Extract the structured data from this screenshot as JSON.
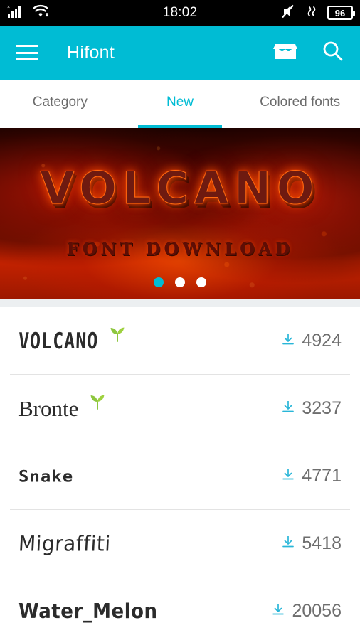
{
  "status_bar": {
    "clock": "18:02",
    "battery_level": "96",
    "icons": [
      "signal-bars-icon",
      "wifi-icon",
      "mute-icon",
      "vibrate-icon",
      "battery-icon"
    ]
  },
  "app_bar": {
    "title": "Hifont",
    "menu_icon": "hamburger-menu-icon",
    "store_icon": "storefront-icon",
    "search_icon": "search-icon"
  },
  "tabs": [
    {
      "label": "Category",
      "active": false
    },
    {
      "label": "New",
      "active": true
    },
    {
      "label": "Colored fonts",
      "active": false
    }
  ],
  "banner": {
    "title": "VOLCANO",
    "subtitle": "FONT DOWNLOAD",
    "dots": [
      true,
      false,
      false
    ]
  },
  "font_list": [
    {
      "name": "VOLCANO",
      "style": "fn-volcano",
      "downloads": "4924",
      "is_new": true
    },
    {
      "name": "Bronte",
      "style": "fn-bronte",
      "downloads": "3237",
      "is_new": true
    },
    {
      "name": "Snake",
      "style": "fn-snake",
      "downloads": "4771",
      "is_new": false
    },
    {
      "name": "Migraffiti",
      "style": "fn-migraffiti",
      "downloads": "5418",
      "is_new": false
    },
    {
      "name": "Water_Melon",
      "style": "fn-watermelon",
      "downloads": "20056",
      "is_new": false
    }
  ],
  "colors": {
    "accent": "#00bcd4",
    "download_icon": "#29b6d8",
    "sprout": "#8dc63f",
    "text_primary": "#2b2b2b",
    "text_secondary": "#6e6e6e"
  }
}
